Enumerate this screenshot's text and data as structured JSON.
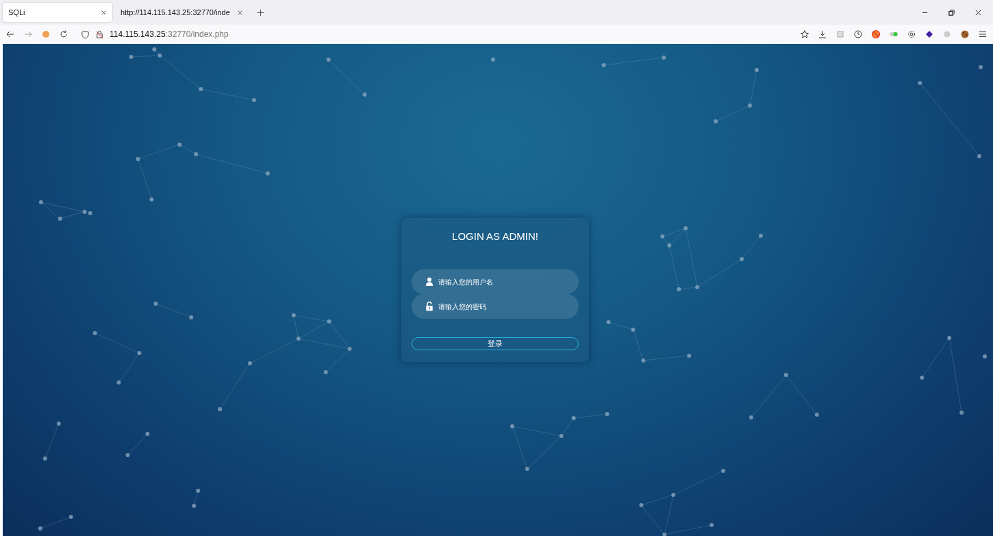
{
  "tabs": [
    {
      "label": "SQLi",
      "selected": true
    },
    {
      "label": "http://114.115.143.25:32770/inde",
      "selected": false
    }
  ],
  "address": {
    "host": "114.115.143.25",
    "rest": ":32770/index.php"
  },
  "login": {
    "title": "LOGIN AS ADMIN!",
    "fields": [
      {
        "kind": "user",
        "placeholder": "请输入您的用户名"
      },
      {
        "kind": "password",
        "placeholder": "请输入您的密码"
      }
    ],
    "button": "登录"
  }
}
